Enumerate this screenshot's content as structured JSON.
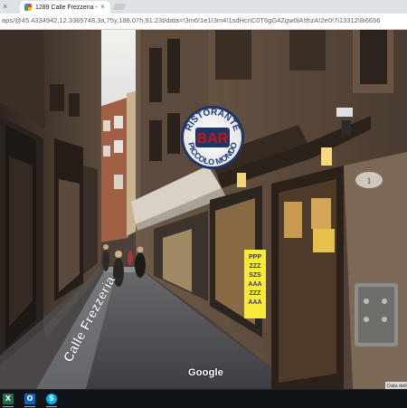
{
  "browser": {
    "prev_tab_close": "×",
    "active_tab_title": "1289 Calle Frezzeria - G",
    "active_tab_close": "×",
    "url": "aps/@45.4334942,12.3365748,3a,75y,188.07h,91.23t/data=!3m6!1e1!3m4!1sdHcnC0T6gG4Zgw0iA!thzA!2e0!7i13312!8i6656"
  },
  "scene": {
    "sign_top": "RISTORANTE",
    "sign_center": "BAR",
    "sign_bottom": "PICCOLO MONDO",
    "street_label": "Calle Frezzeria",
    "poster_text": [
      "PPP",
      "ZZZ",
      "SZS",
      "AAA",
      "ZZZ",
      "AAA"
    ],
    "house_number": "1",
    "google_watermark": "Google",
    "copyright": "Data della"
  },
  "taskbar": {
    "apps": [
      {
        "name": "excel",
        "glyph": "X"
      },
      {
        "name": "outlook",
        "glyph": "O"
      },
      {
        "name": "skype",
        "glyph": "S"
      }
    ]
  }
}
